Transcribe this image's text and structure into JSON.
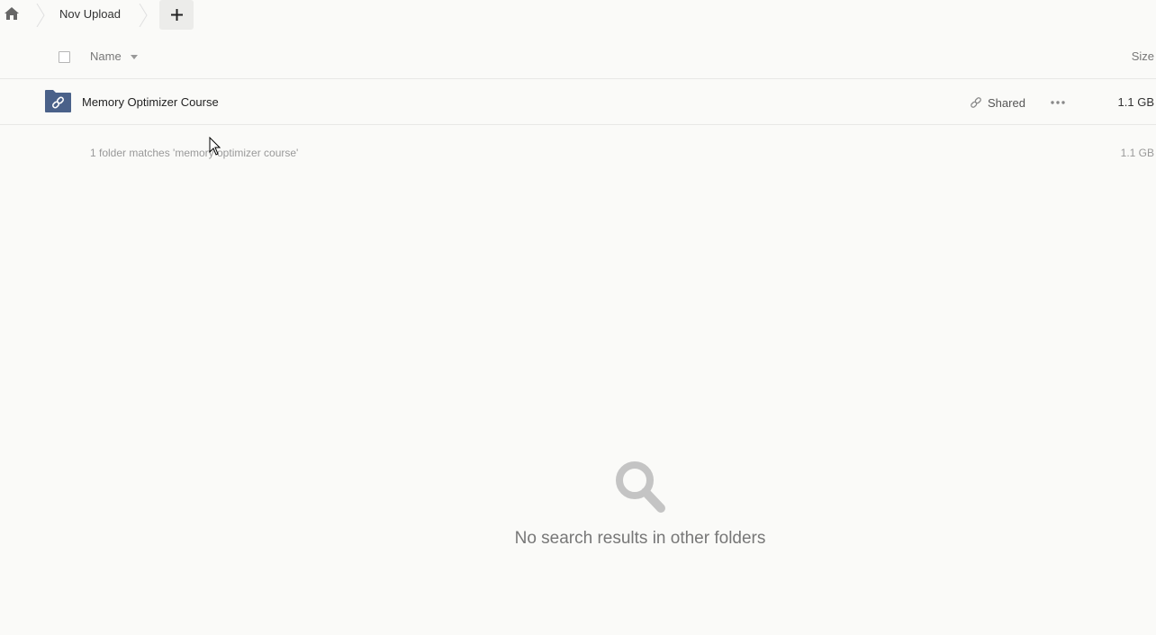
{
  "breadcrumb": {
    "home_icon": "home-icon",
    "current_folder": "Nov Upload",
    "add_icon": "plus-icon"
  },
  "columns": {
    "name": "Name",
    "size": "Size"
  },
  "rows": [
    {
      "icon": "shared-folder-icon",
      "name": "Memory Optimizer Course",
      "shared_label": "Shared",
      "size": "1.1 GB"
    }
  ],
  "summary": {
    "text": "1 folder matches 'memory optimizer course'",
    "size": "1.1 GB"
  },
  "empty_state": {
    "icon": "search-icon",
    "message": "No search results in other folders"
  },
  "colors": {
    "background": "#fafaf8",
    "folder": "#4a6189",
    "muted_text": "#999999"
  }
}
